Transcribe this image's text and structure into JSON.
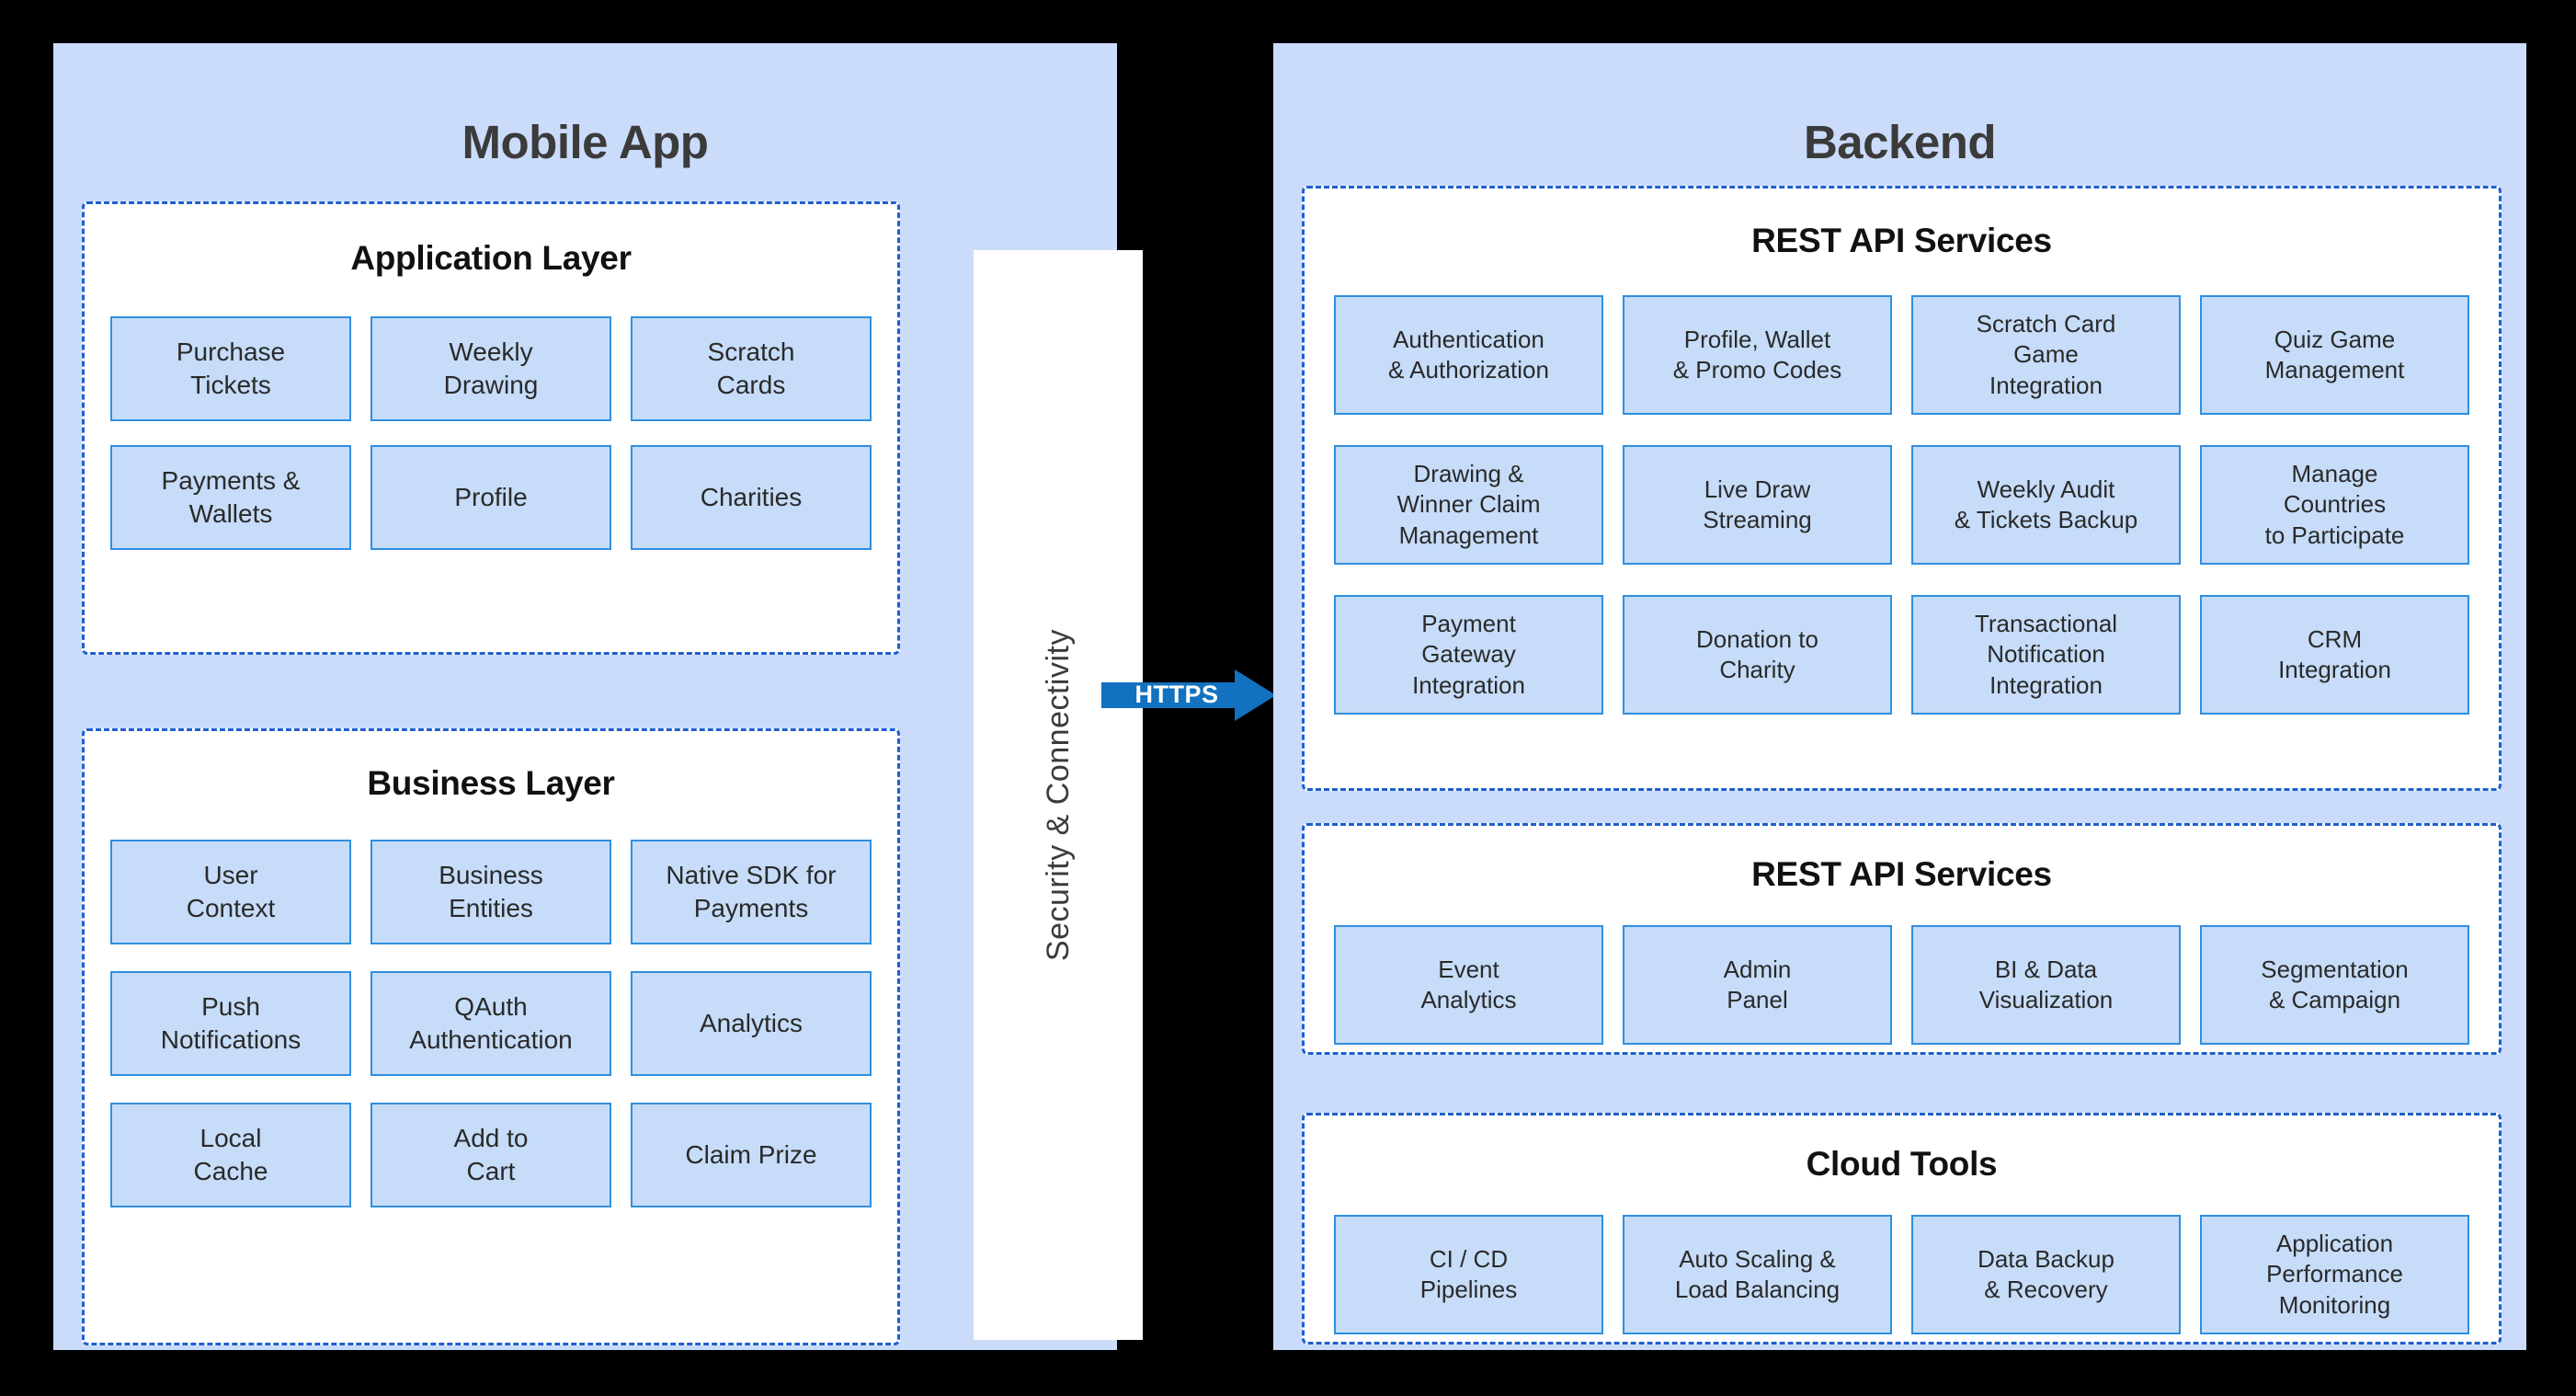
{
  "colors": {
    "panel_background": "#cbdcfb",
    "group_background": "#ffffff",
    "group_border": "#1f5fd0",
    "card_background": "#c6dcf8",
    "card_border": "#2f8fe0",
    "arrow": "#1272c0",
    "canvas": "#000000",
    "title_text": "#3b3b3b"
  },
  "mobile": {
    "title": "Mobile App",
    "app_layer": {
      "title": "Application Layer",
      "cards": [
        "Purchase\nTickets",
        "Weekly\nDrawing",
        "Scratch\nCards",
        "Payments &\nWallets",
        "Profile",
        "Charities"
      ]
    },
    "business_layer": {
      "title": "Business Layer",
      "cards": [
        "User\nContext",
        "Business\nEntities",
        "Native SDK for\nPayments",
        "Push\nNotifications",
        "QAuth\nAuthentication",
        "Analytics",
        "Local\nCache",
        "Add to\nCart",
        "Claim Prize"
      ]
    }
  },
  "security_bar": {
    "label": "Security & Connectivity"
  },
  "connector": {
    "label": "HTTPS",
    "direction": "right",
    "icon": "arrow-right-icon"
  },
  "backend": {
    "title": "Backend",
    "rest_api_1": {
      "title": "REST API Services",
      "cards": [
        "Authentication\n& Authorization",
        "Profile, Wallet\n& Promo Codes",
        "Scratch Card\nGame\nIntegration",
        "Quiz Game\nManagement",
        "Drawing &\nWinner Claim\nManagement",
        "Live Draw\nStreaming",
        "Weekly Audit\n& Tickets Backup",
        "Manage\nCountries\nto Participate",
        "Payment\nGateway\nIntegration",
        "Donation to\nCharity",
        "Transactional\nNotification\nIntegration",
        "CRM\nIntegration"
      ]
    },
    "rest_api_2": {
      "title": "REST API Services",
      "cards": [
        "Event\nAnalytics",
        "Admin\nPanel",
        "BI & Data\nVisualization",
        "Segmentation\n& Campaign"
      ]
    },
    "cloud_tools": {
      "title": "Cloud Tools",
      "cards": [
        "CI / CD\nPipelines",
        "Auto Scaling &\nLoad Balancing",
        "Data Backup\n& Recovery",
        "Application\nPerformance\nMonitoring"
      ]
    }
  }
}
